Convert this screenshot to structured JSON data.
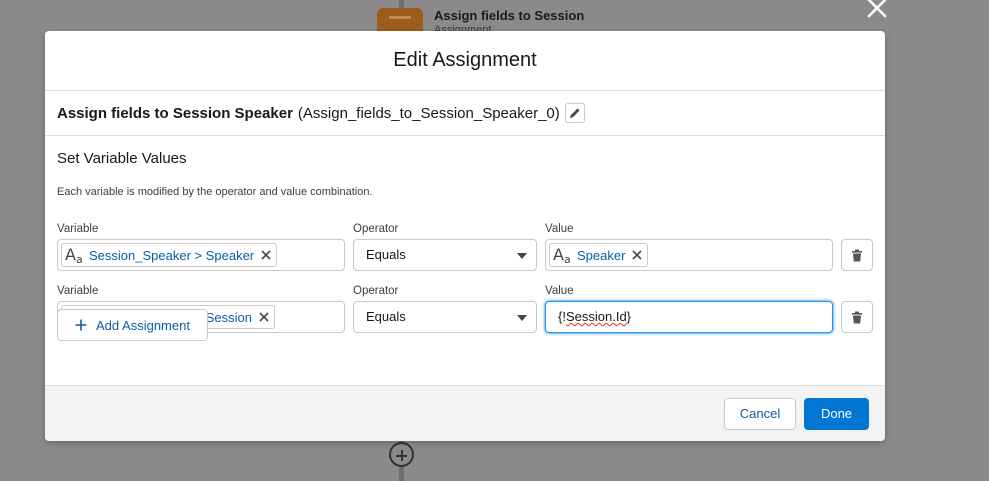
{
  "background": {
    "node_title": "Assign fields to Session",
    "node_subtitle": "Assignment"
  },
  "modal": {
    "title": "Edit Assignment",
    "element_label": "Assign fields to Session Speaker",
    "element_api_name": "(Assign_fields_to_Session_Speaker_0)",
    "section_title": "Set Variable Values",
    "help_text": "Each variable is modified by the operator and value combination.",
    "rows": [
      {
        "variable_label": "Variable",
        "variable_value": "Session_Speaker > Speaker",
        "operator_label": "Operator",
        "operator_value": "Equals",
        "value_label": "Value",
        "value_pill": "Speaker"
      },
      {
        "variable_label": "Variable",
        "variable_value": "Session_Speaker > Session",
        "operator_label": "Operator",
        "operator_value": "Equals",
        "value_label": "Value",
        "value_prefix": "{!",
        "value_text": "Session.Id",
        "value_suffix": "}"
      }
    ],
    "add_assignment_label": "Add Assignment",
    "cancel_label": "Cancel",
    "done_label": "Done"
  },
  "colors": {
    "brand": "#0176d3",
    "link": "#0b5cab",
    "border": "#c9c9c9",
    "overlay": "#8a8a8a"
  },
  "icons": [
    "close-icon",
    "pencil-icon",
    "text-resource-icon",
    "remove-icon",
    "chevron-down-icon",
    "trash-icon",
    "plus-icon",
    "add-element-icon"
  ]
}
